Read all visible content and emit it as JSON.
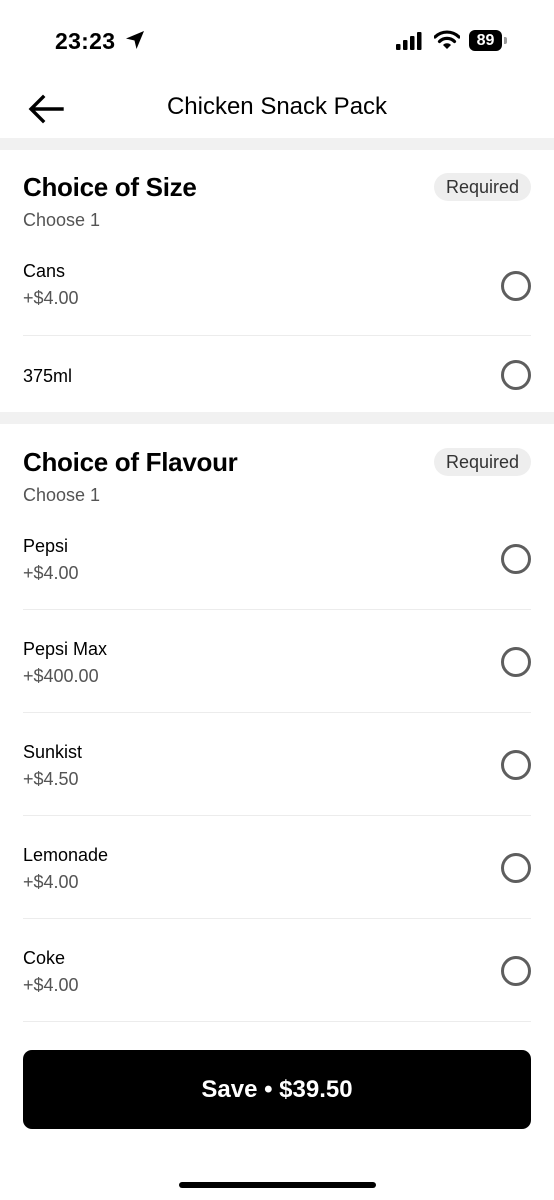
{
  "status_bar": {
    "time": "23:23",
    "battery": "89"
  },
  "header": {
    "title": "Chicken Snack Pack"
  },
  "sections": [
    {
      "title": "Choice of Size",
      "badge": "Required",
      "subtitle": "Choose 1",
      "options": [
        {
          "name": "Cans",
          "price": "+$4.00"
        },
        {
          "name": "375ml",
          "price": ""
        }
      ]
    },
    {
      "title": "Choice of Flavour",
      "badge": "Required",
      "subtitle": "Choose 1",
      "options": [
        {
          "name": "Pepsi",
          "price": "+$4.00"
        },
        {
          "name": "Pepsi Max",
          "price": "+$400.00"
        },
        {
          "name": "Sunkist",
          "price": "+$4.50"
        },
        {
          "name": "Lemonade",
          "price": "+$4.00"
        },
        {
          "name": "Coke",
          "price": "+$4.00"
        }
      ]
    }
  ],
  "footer": {
    "save_label": "Save • $39.50"
  },
  "icons": {
    "location": "location-arrow-icon",
    "signal": "cellular-signal-icon",
    "wifi": "wifi-icon",
    "back": "back-arrow-icon"
  }
}
